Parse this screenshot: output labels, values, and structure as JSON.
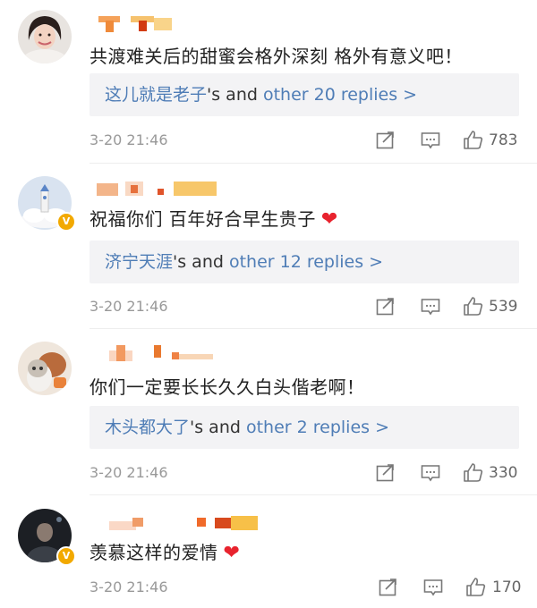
{
  "comments": [
    {
      "text": "共渡难关后的甜蜜会格外深刻 格外有意义吧！",
      "reply_user": "这儿就是老子",
      "reply_suffix": "'s and ",
      "reply_other": "other 20 replies >",
      "date": "3-20 21:46",
      "likes": "783",
      "verified": false
    },
    {
      "text": "祝福你们 百年好合早生贵子",
      "emoji": "❤",
      "reply_user": "济宁天涯",
      "reply_suffix": "'s and ",
      "reply_other": "other 12 replies >",
      "date": "3-20 21:46",
      "likes": "539",
      "verified": true,
      "badge": "V"
    },
    {
      "text": "你们一定要长长久久白头偕老啊！",
      "reply_user": "木头都大了",
      "reply_suffix": "'s and ",
      "reply_other": "other 2 replies >",
      "date": "3-20 21:46",
      "likes": "330",
      "verified": false
    },
    {
      "text": "羡慕这样的爱情",
      "emoji": "❤",
      "date": "3-20 21:46",
      "likes": "170",
      "verified": true,
      "badge": "V"
    }
  ],
  "colors": {
    "link": "#4f7db6",
    "heart": "#e8232e",
    "badge": "#f2a900",
    "reply_bg": "#f3f3f5",
    "meta_text": "#999999"
  },
  "icons": [
    "share-icon",
    "comment-icon",
    "like-icon"
  ]
}
